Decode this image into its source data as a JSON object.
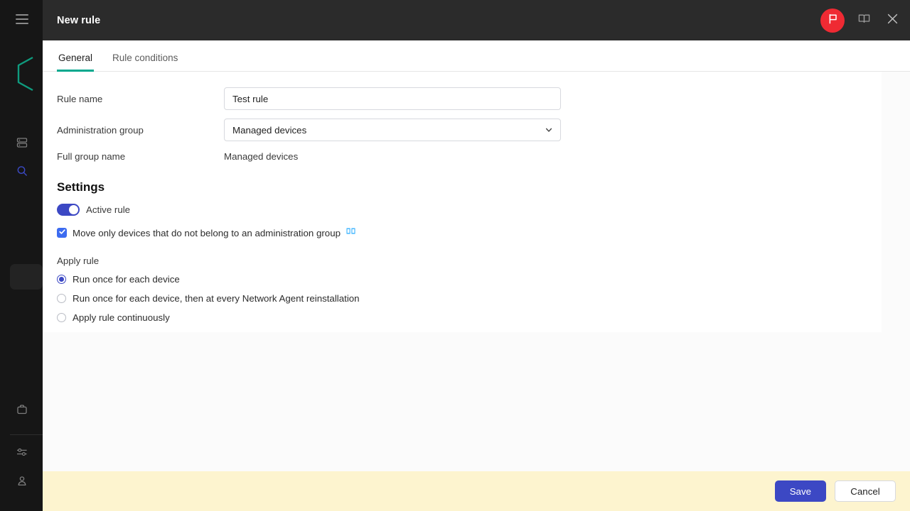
{
  "app_rail": {
    "hamburger": "menu-icon",
    "logo": "hexagon-logo",
    "items": [
      {
        "icon": "server-icon",
        "name": "servers"
      },
      {
        "icon": "search-icon",
        "name": "search"
      },
      {
        "icon": "briefcase-icon",
        "name": "assets"
      },
      {
        "icon": "sliders-icon",
        "name": "settings"
      },
      {
        "icon": "user-icon",
        "name": "account"
      }
    ]
  },
  "header": {
    "title": "New rule",
    "flag_icon": "flag-icon",
    "help_icon": "book-icon",
    "close_icon": "close-icon"
  },
  "tabs": [
    {
      "label": "General",
      "active": true
    },
    {
      "label": "Rule conditions",
      "active": false
    }
  ],
  "form": {
    "rule_name": {
      "label": "Rule name",
      "value": "Test rule",
      "placeholder": "Rule name"
    },
    "administration_group": {
      "label": "Administration group",
      "value": "Managed devices",
      "chevron": "chevron-down-icon"
    },
    "full_group_name": {
      "label": "Full group name",
      "value": "Managed devices"
    }
  },
  "settings": {
    "title": "Settings",
    "active_rule": {
      "label": "Active rule",
      "on": true
    },
    "move_only": {
      "label": "Move only devices that do not belong to an administration group",
      "checked": true,
      "help_icon": "book-icon"
    },
    "apply_rule": {
      "label": "Apply rule",
      "options": [
        {
          "label": "Run once for each device",
          "selected": true
        },
        {
          "label": "Run once for each device, then at every Network Agent reinstallation",
          "selected": false
        },
        {
          "label": "Apply rule continuously",
          "selected": false
        }
      ]
    }
  },
  "footer": {
    "save_label": "Save",
    "cancel_label": "Cancel"
  },
  "colors": {
    "accent_teal": "#00a88e",
    "primary_blue": "#3c48c4",
    "checkbox_blue": "#3c6bf0",
    "flag_red": "#ef2a33",
    "footer_yellow": "#fdf4cf",
    "header_dark": "#2b2b2b",
    "rail_dark": "#161616"
  }
}
